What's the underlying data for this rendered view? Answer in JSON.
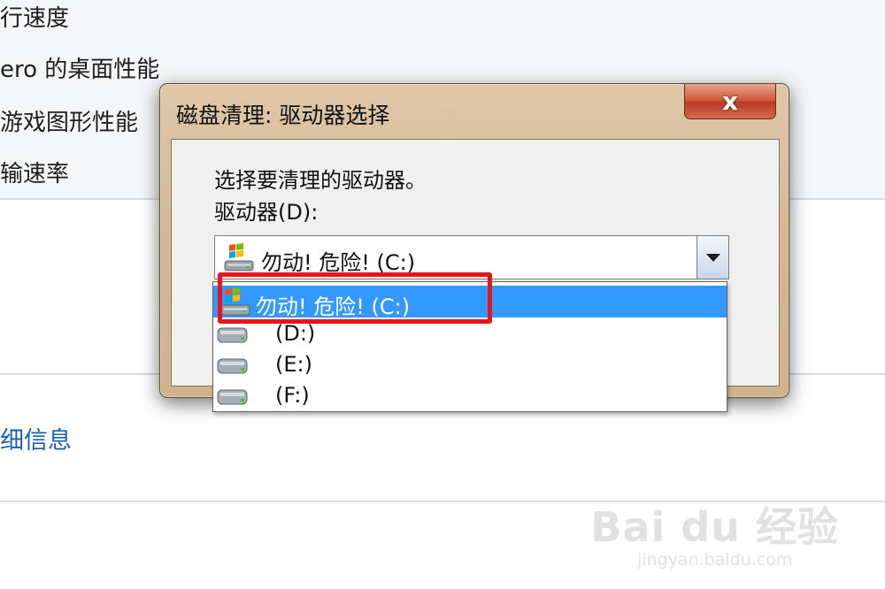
{
  "background": {
    "rows": [
      "行速度",
      "ero 的桌面性能",
      "游戏图形性能",
      "输速率"
    ],
    "link": "细信息"
  },
  "dialog": {
    "title": "磁盘清理: 驱动器选择",
    "close_label": "x",
    "prompt": "选择要清理的驱动器。",
    "drive_label": "驱动器(D):",
    "selected_value": "勿动! 危险!  (C:)",
    "options": [
      {
        "label": "勿动! 危险!  (C:)",
        "icon": "windows-drive-icon",
        "selected": true
      },
      {
        "label": "(D:)",
        "icon": "hard-drive-icon",
        "selected": false
      },
      {
        "label": "(E:)",
        "icon": "hard-drive-icon",
        "selected": false
      },
      {
        "label": "(F:)",
        "icon": "hard-drive-icon",
        "selected": false
      }
    ]
  },
  "annotation": {
    "highlight_color": "#e8141c"
  },
  "watermark": {
    "logo": "Bai du 经验",
    "url": "jingyan.baidu.com"
  },
  "colors": {
    "selection": "#3399ff",
    "dialog_frame": "#d5b995",
    "close_button": "#d2553a"
  }
}
